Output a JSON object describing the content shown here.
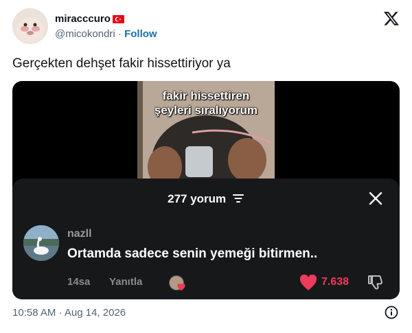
{
  "author": {
    "display_name": "miracccuro",
    "handle": "@micokondri",
    "separator": "·",
    "follow_label": "Follow"
  },
  "tweet": {
    "text": "Gerçekten dehşet fakir hissettiriyor ya",
    "timestamp": "10:58 AM · Aug 14, 2026"
  },
  "video": {
    "overlay_line1": "fakir hissettiren",
    "overlay_line2": "şeyleri sıralıyorum"
  },
  "comments_sheet": {
    "count_label": "277 yorum",
    "comment": {
      "author": "nazll",
      "text": "Ortamda sadece senin yemeği bitirmen..",
      "time": "14sa",
      "reply_label": "Yanıtla",
      "likes": "7.638"
    }
  },
  "colors": {
    "link": "#1d6fa5",
    "like": "#ee3a5b",
    "sheet_bg": "#17181a"
  },
  "icons": [
    "x-logo-icon",
    "flag-tr-icon",
    "filter-icon",
    "close-icon",
    "heart-icon",
    "dislike-icon",
    "info-icon"
  ]
}
